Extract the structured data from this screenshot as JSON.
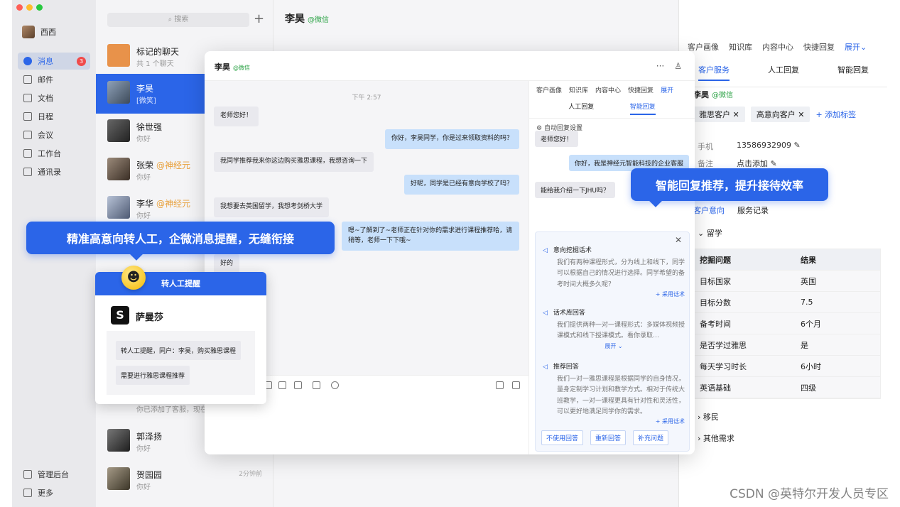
{
  "window": {
    "traffic_colors": [
      "#ff5f57",
      "#febc2e",
      "#28c840"
    ]
  },
  "nav": {
    "user_name": "西西",
    "items": [
      {
        "label": "消息",
        "icon": "message-icon",
        "badge": "3"
      },
      {
        "label": "邮件",
        "icon": "mail-icon"
      },
      {
        "label": "文档",
        "icon": "document-icon"
      },
      {
        "label": "日程",
        "icon": "calendar-icon"
      },
      {
        "label": "会议",
        "icon": "meeting-icon"
      },
      {
        "label": "工作台",
        "icon": "workbench-icon"
      },
      {
        "label": "通讯录",
        "icon": "contacts-icon"
      }
    ],
    "bottom": [
      {
        "label": "管理后台",
        "icon": "admin-icon"
      },
      {
        "label": "更多",
        "icon": "menu-icon"
      }
    ]
  },
  "conversations": {
    "search_placeholder": "搜索",
    "items": [
      {
        "name": "标记的聊天",
        "sub": "共 1 个聊天",
        "tag": ""
      },
      {
        "name": "李昊",
        "sub": "[微笑]",
        "tag": ""
      },
      {
        "name": "徐世强",
        "sub": "你好",
        "tag": ""
      },
      {
        "name": "张荣",
        "sub": "你好",
        "tag": "@神经元"
      },
      {
        "name": "李华",
        "sub": "你好",
        "tag": "@神经元"
      },
      {
        "name": "",
        "sub": "你已添加了客服，现在",
        "tag": ""
      },
      {
        "name": "郭泽扬",
        "sub": "你好",
        "tag": ""
      },
      {
        "name": "贺园园",
        "sub": "你好",
        "tag": "",
        "time": "2分钟前"
      }
    ]
  },
  "main": {
    "title": "李昊",
    "source": "@微信"
  },
  "right_panel": {
    "tabs": [
      "客户画像",
      "知识库",
      "内容中心",
      "快捷回复"
    ],
    "tabs_more": "展开",
    "subtabs": [
      "客户服务",
      "人工回复",
      "智能回复"
    ],
    "name": "李昊",
    "source": "@微信",
    "tags": [
      "雅思客户",
      "高意向客户"
    ],
    "add_tag": "+ 添加标签",
    "phone_label": "手机",
    "phone": "13586932909",
    "note_label": "备注",
    "note": "点击添加",
    "tabs2": [
      "客户意向",
      "服务记录"
    ],
    "section1": "留学",
    "table_head": [
      "挖掘问题",
      "结果"
    ],
    "table_rows": [
      [
        "目标国家",
        "英国"
      ],
      [
        "目标分数",
        "7.5"
      ],
      [
        "备考时间",
        "6个月"
      ],
      [
        "是否学过雅思",
        "是"
      ],
      [
        "每天学习时长",
        "6小时"
      ],
      [
        "英语基础",
        "四级"
      ]
    ],
    "section2": "移民",
    "section3": "其他需求"
  },
  "modal": {
    "title": "李昊",
    "source": "@微信",
    "time": "下午 2:57",
    "messages": [
      {
        "side": "l",
        "text": "老师您好！"
      },
      {
        "side": "r",
        "text": "你好，李昊同学，你是过来领取资料的吗？"
      },
      {
        "side": "l",
        "text": "我同学推荐我来你这边购买雅思课程，我想咨询一下"
      },
      {
        "side": "r",
        "text": "好呢，同学是已经有意向学校了吗？"
      },
      {
        "side": "l",
        "text": "我想要去英国留学，我想考剑桥大学"
      },
      {
        "side": "r",
        "text": "嗯~了解到了~老师正在针对你的需求进行课程推荐哈，请稍等，老师一下下哦~"
      },
      {
        "side": "l",
        "text": "好的"
      }
    ],
    "side_tabs": [
      "客户画像",
      "知识库",
      "内容中心",
      "快捷回复"
    ],
    "side_more": "展开",
    "side_subtabs": [
      "人工回复",
      "智能回复"
    ],
    "auto_reply": "自动回复设置",
    "side_msgs": [
      {
        "side": "l",
        "text": "老师您好！"
      },
      {
        "side": "r",
        "text": "你好，我是神经元智能科技的企业客服"
      },
      {
        "side": "l",
        "text": "能给我介绍一下JHU吗？"
      }
    ],
    "suggestions": [
      {
        "title": "意向挖掘话术",
        "body": "我们有两种课程形式，分为线上和线下，同学可以根据自己的情况进行选择。同学希望的备考时间大概多久呢？",
        "more": "+ 采用话术"
      },
      {
        "title": "话术库回答",
        "body": "我们提供两种一对一课程形式：多媒体视频授课模式和线下授课模式。看你录取…",
        "more": "展开 ⌄"
      },
      {
        "title": "推荐回答",
        "body": "我们一对一雅思课程是根据同学的自身情况，量身定制学习计划和教学方式。相对于传统大班教学，一对一课程更具有针对性和灵活性，可以更好地满足同学你的需求。",
        "more": "+ 采用话术"
      }
    ],
    "buttons": [
      "不使用回答",
      "重新回答",
      "补充问题"
    ]
  },
  "callouts": {
    "left": "精准高意向转人工，企微消息提醒，无缝衔接",
    "right": "智能回复推荐，提升接待效率"
  },
  "popup": {
    "header": "转人工提醒",
    "app_name": "萨曼莎",
    "msg1": "转人工提醒，同户：李昊，购买雅思课程",
    "msg2": "需要进行雅思课程推荐"
  },
  "watermark": "CSDN @英特尔开发人员专区"
}
